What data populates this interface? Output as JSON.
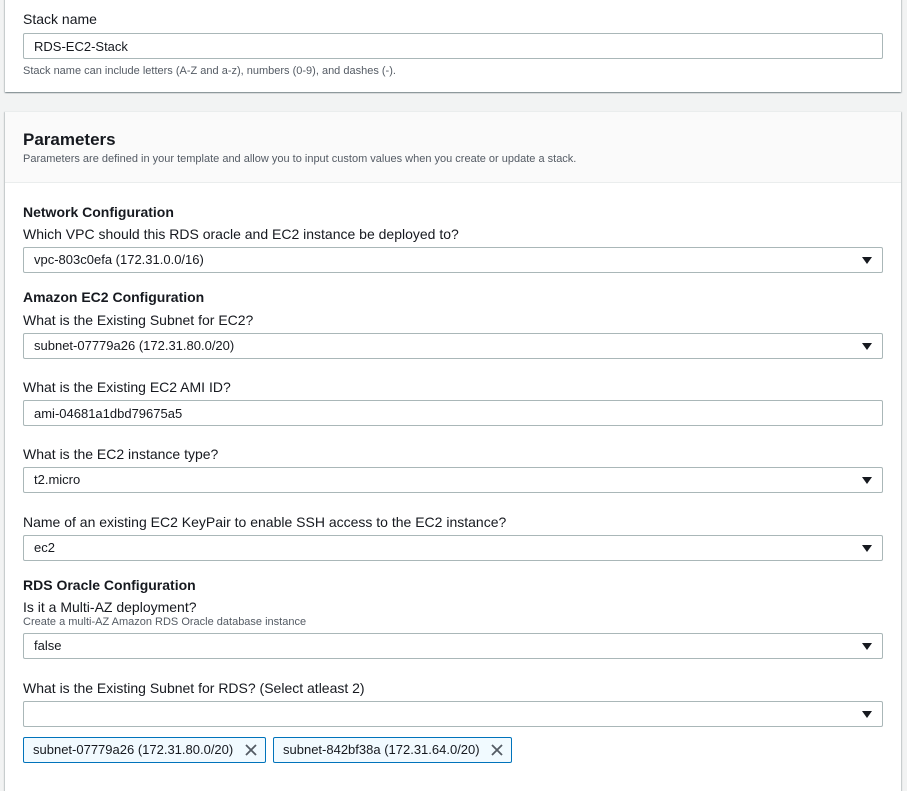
{
  "stack": {
    "label": "Stack name",
    "value": "RDS-EC2-Stack",
    "hint": "Stack name can include letters (A-Z and a-z), numbers (0-9), and dashes (-)."
  },
  "parameters": {
    "title": "Parameters",
    "description": "Parameters are defined in your template and allow you to input custom values when you create or update a stack."
  },
  "network": {
    "title": "Network Configuration",
    "vpc_label": "Which VPC should this RDS oracle and EC2 instance be deployed to?",
    "vpc_value": "vpc-803c0efa (172.31.0.0/16)"
  },
  "ec2": {
    "title": "Amazon EC2 Configuration",
    "subnet_label": "What is the Existing Subnet for EC2?",
    "subnet_value": "subnet-07779a26 (172.31.80.0/20)",
    "ami_label": "What is the Existing EC2 AMI ID?",
    "ami_value": "ami-04681a1dbd79675a5",
    "type_label": "What is the EC2 instance type?",
    "type_value": "t2.micro",
    "keypair_label": "Name of an existing EC2 KeyPair to enable SSH access to the EC2 instance?",
    "keypair_value": "ec2"
  },
  "rds": {
    "title": "RDS Oracle Configuration",
    "multiaz_label": "Is it a Multi-AZ deployment?",
    "multiaz_desc": "Create a multi-AZ Amazon RDS Oracle database instance",
    "multiaz_value": "false",
    "subnet_label": "What is the Existing Subnet for RDS? (Select atleast 2)",
    "subnet_value": "",
    "tokens": [
      "subnet-07779a26 (172.31.80.0/20)",
      "subnet-842bf38a (172.31.64.0/20)"
    ]
  },
  "icons": {
    "caret": "caret-down-icon",
    "remove": "close-icon"
  },
  "colors": {
    "token_border": "#0073bb",
    "token_bg": "#f1faff"
  }
}
